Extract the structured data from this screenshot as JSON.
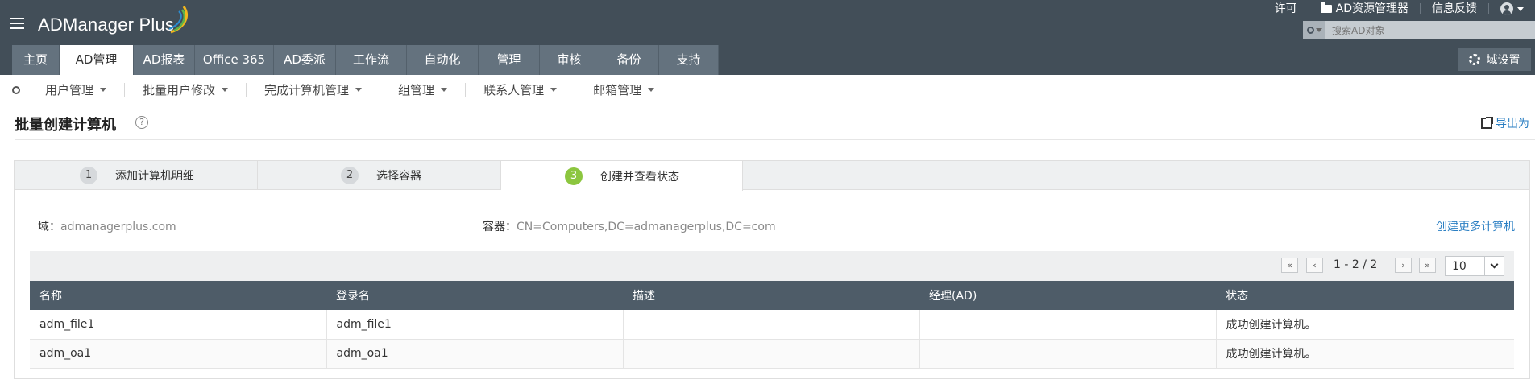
{
  "app": {
    "name": "ADManager Plus",
    "colors": {
      "header_bg": "#424e58",
      "tab_bg": "#64727e",
      "accent_link": "#2b7fc3",
      "step_active": "#8cc63f"
    }
  },
  "top_links": {
    "license": "许可",
    "ad_explorer": "AD资源管理器",
    "feedback": "信息反馈"
  },
  "search": {
    "placeholder": "搜索AD对象"
  },
  "tabs": [
    {
      "label": "主页"
    },
    {
      "label": "AD管理"
    },
    {
      "label": "AD报表"
    },
    {
      "label": "Office 365"
    },
    {
      "label": "AD委派"
    },
    {
      "label": "工作流"
    },
    {
      "label": "自动化"
    },
    {
      "label": "管理"
    },
    {
      "label": "审核"
    },
    {
      "label": "备份"
    },
    {
      "label": "支持"
    }
  ],
  "domain_settings_label": "域设置",
  "subnav": [
    {
      "label": "用户管理"
    },
    {
      "label": "批量用户修改"
    },
    {
      "label": "完成计算机管理"
    },
    {
      "label": "组管理"
    },
    {
      "label": "联系人管理"
    },
    {
      "label": "邮箱管理"
    }
  ],
  "page": {
    "title": "批量创建计算机",
    "help": "?",
    "export_label": "导出为"
  },
  "steps": [
    {
      "num": "1",
      "label": "添加计算机明细"
    },
    {
      "num": "2",
      "label": "选择容器"
    },
    {
      "num": "3",
      "label": "创建并查看状态"
    }
  ],
  "info": {
    "domain_label": "域：",
    "domain_value": "admanagerplus.com",
    "container_label": "容器：",
    "container_value": "CN=Computers,DC=admanagerplus,DC=com",
    "create_more": "创建更多计算机"
  },
  "pager": {
    "first": "«",
    "prev": "‹",
    "range": "1 - 2 /  2",
    "next": "›",
    "last": "»",
    "page_size": "10"
  },
  "table": {
    "headers": [
      "名称",
      "登录名",
      "描述",
      "经理(AD)",
      "状态"
    ],
    "rows": [
      [
        "adm_file1",
        "adm_file1",
        "",
        "",
        "成功创建计算机。"
      ],
      [
        "adm_oa1",
        "adm_oa1",
        "",
        "",
        "成功创建计算机。"
      ]
    ]
  }
}
